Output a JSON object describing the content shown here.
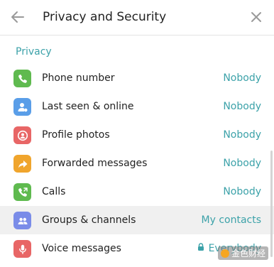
{
  "header": {
    "title": "Privacy and Security",
    "back_icon": "arrow-left-icon",
    "close_icon": "close-icon"
  },
  "section": {
    "title": "Privacy"
  },
  "items": [
    {
      "label": "Phone number",
      "value": "Nobody",
      "icon": "phone-icon",
      "color": "#5fba4f"
    },
    {
      "label": "Last seen & online",
      "value": "Nobody",
      "icon": "user-clock-icon",
      "color": "#5a9ee8"
    },
    {
      "label": "Profile photos",
      "value": "Nobody",
      "icon": "profile-photo-icon",
      "color": "#e86666"
    },
    {
      "label": "Forwarded messages",
      "value": "Nobody",
      "icon": "forward-icon",
      "color": "#f0a52d"
    },
    {
      "label": "Calls",
      "value": "Nobody",
      "icon": "calls-icon",
      "color": "#5fba4f"
    },
    {
      "label": "Groups & channels",
      "value": "My contacts",
      "icon": "group-icon",
      "color": "#7a8ce8"
    },
    {
      "label": "Voice messages",
      "value": "Everybody",
      "icon": "microphone-icon",
      "color": "#e86666",
      "locked": true
    }
  ],
  "colors": {
    "accent": "#3ca2a9",
    "highlight_row": "#f0f0f0"
  },
  "watermark": {
    "text": "金色财经"
  }
}
